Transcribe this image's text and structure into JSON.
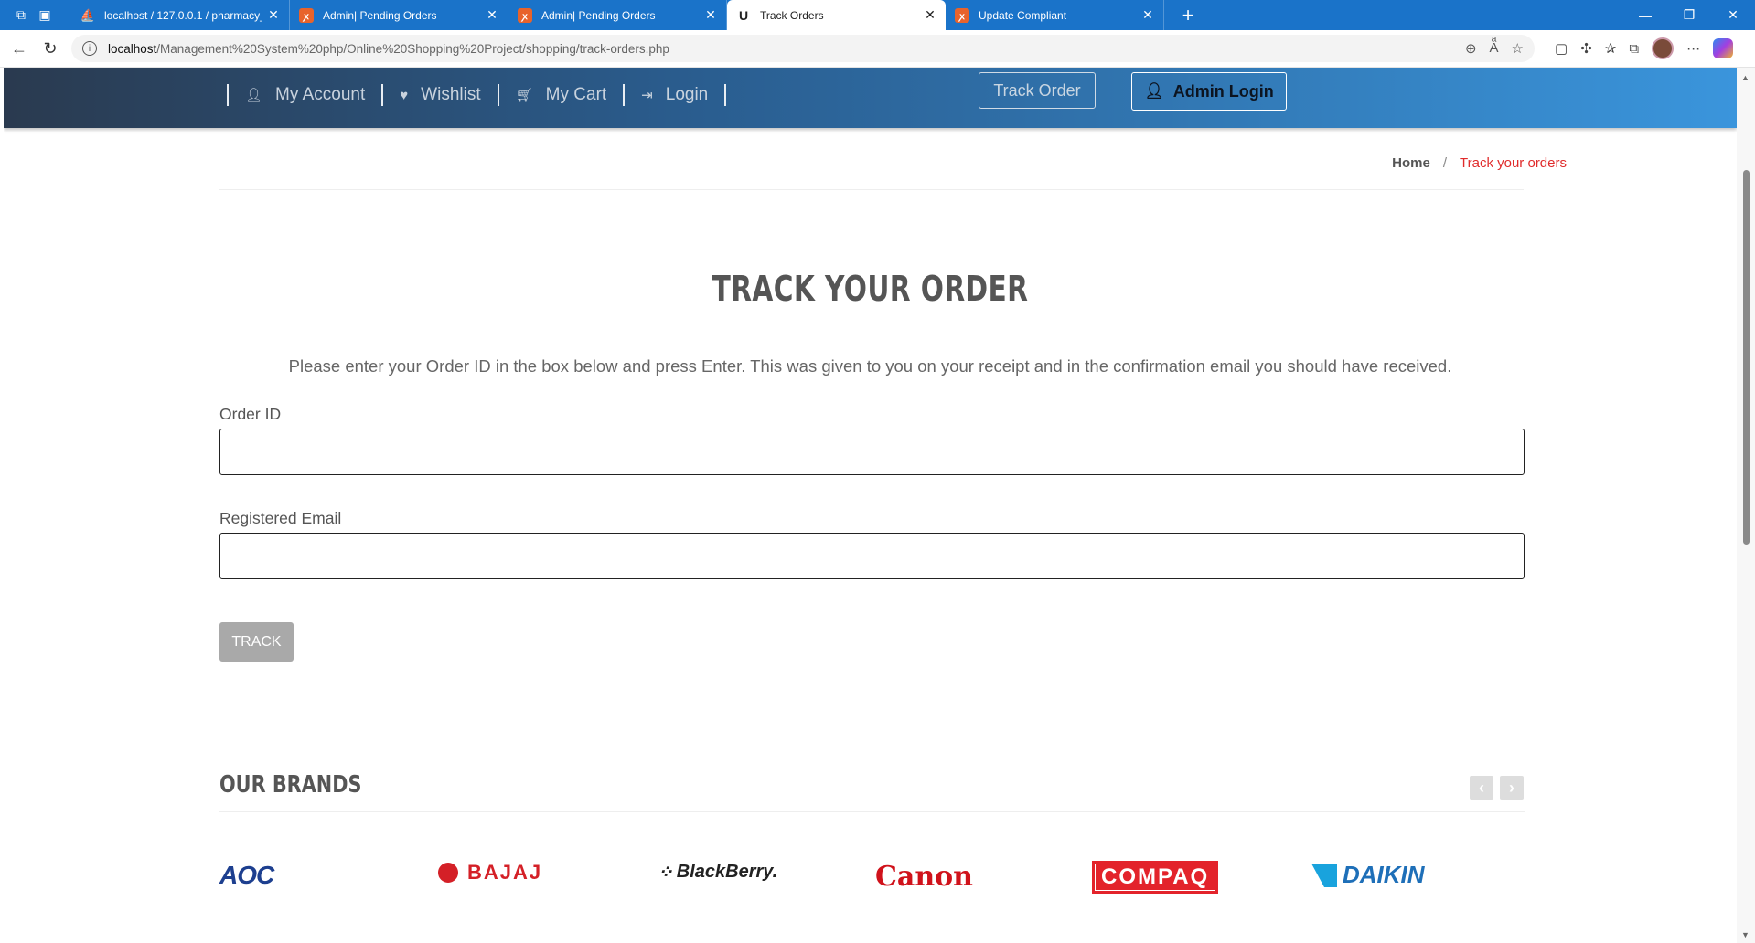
{
  "browser": {
    "tabs": [
      {
        "title": "localhost / 127.0.0.1 / pharmacy_",
        "icon": "phpmyadmin-icon",
        "active": false
      },
      {
        "title": "Admin| Pending Orders",
        "icon": "xampp-icon",
        "active": false
      },
      {
        "title": "Admin| Pending Orders",
        "icon": "xampp-icon",
        "active": false
      },
      {
        "title": "Track Orders",
        "icon": "u-icon",
        "active": true
      },
      {
        "title": "Update Compliant",
        "icon": "xampp-icon",
        "active": false
      }
    ],
    "url_host": "localhost",
    "url_path": "/Management%20System%20php/Online%20Shopping%20Project/shopping/track-orders.php",
    "accent_color": "#1a73c9"
  },
  "header": {
    "links": [
      {
        "label": "My Account",
        "icon": "user-icon"
      },
      {
        "label": "Wishlist",
        "icon": "heart-icon"
      },
      {
        "label": "My Cart",
        "icon": "cart-icon"
      },
      {
        "label": "Login",
        "icon": "login-icon"
      }
    ],
    "track_order_label": "Track Order",
    "admin_login_label": "Admin Login"
  },
  "breadcrumb": {
    "home": "Home",
    "separator": "/",
    "current": "Track your orders",
    "current_color": "#e02b2b"
  },
  "main": {
    "heading": "TRACK YOUR ORDER",
    "intro": "Please enter your Order ID in the box below and press Enter. This was given to you on your receipt and in the confirmation email you should have received.",
    "order_id_label": "Order ID",
    "order_id_value": "",
    "email_label": "Registered Email",
    "email_value": "",
    "submit_label": "TRACK"
  },
  "brands": {
    "title": "OUR BRANDS",
    "items": [
      {
        "name": "AOC",
        "logo_text": "AOC"
      },
      {
        "name": "Bajaj",
        "logo_text": "BAJAJ"
      },
      {
        "name": "BlackBerry",
        "logo_text": "BlackBerry."
      },
      {
        "name": "Canon",
        "logo_text": "Canon"
      },
      {
        "name": "Compaq",
        "logo_text": "COMPAQ"
      },
      {
        "name": "Daikin",
        "logo_text": "DAIKIN"
      }
    ]
  }
}
